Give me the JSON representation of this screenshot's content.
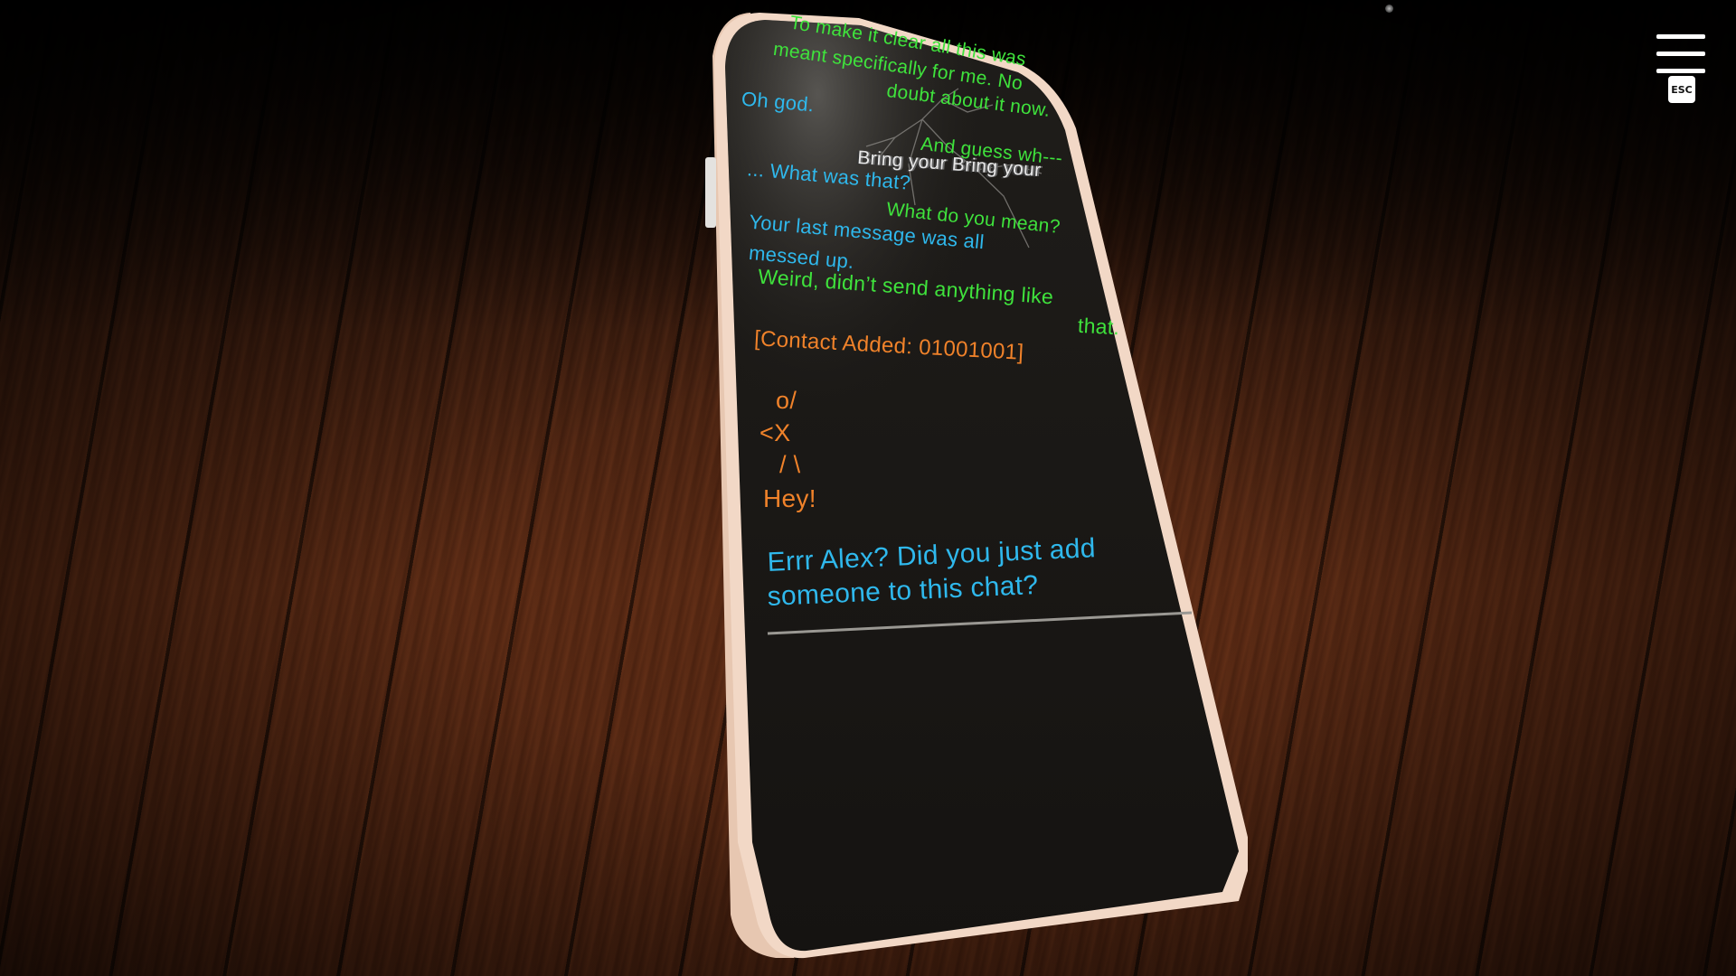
{
  "hud": {
    "menu_icon": "hamburger-menu-icon",
    "esc_label": "ESC"
  },
  "chat": {
    "messages": [
      {
        "sender": "friend",
        "color": "green",
        "text": "To make it clear all this was"
      },
      {
        "sender": "friend",
        "color": "green",
        "text": "meant specifically for me. No"
      },
      {
        "sender": "friend",
        "color": "green",
        "text": "doubt about it now."
      },
      {
        "sender": "player",
        "color": "cyan",
        "text": "Oh god."
      },
      {
        "sender": "friend",
        "color": "green",
        "text": "And guess wh---"
      },
      {
        "sender": "glitch",
        "color": "white",
        "text": "Bring your Bring your"
      },
      {
        "sender": "player",
        "color": "cyan",
        "text": "... What was that?"
      },
      {
        "sender": "friend",
        "color": "green",
        "text": "What do you mean?"
      },
      {
        "sender": "player",
        "color": "cyan",
        "text": "Your last message was all"
      },
      {
        "sender": "player",
        "color": "cyan",
        "text": "messed up."
      },
      {
        "sender": "friend",
        "color": "green",
        "text": "Weird, didn’t send anything like"
      },
      {
        "sender": "friend",
        "color": "green",
        "text": "that."
      },
      {
        "sender": "system",
        "color": "orange",
        "text": "[Contact Added: 01001001]"
      },
      {
        "sender": "stranger",
        "color": "orange",
        "text": "o/"
      },
      {
        "sender": "stranger",
        "color": "orange",
        "text": "<X"
      },
      {
        "sender": "stranger",
        "color": "orange",
        "text": "/ \\"
      },
      {
        "sender": "stranger",
        "color": "orange",
        "text": "Hey!"
      }
    ],
    "reply_option": {
      "line1": "Errr Alex? Did you just add",
      "line2": "someone to this chat?"
    }
  },
  "colors": {
    "friend_text": "#3fe23c",
    "player_text": "#2fb8ec",
    "system_text": "#f0822a",
    "phone_screen": "#1a1815",
    "phone_frame": "#f2d8c6"
  }
}
